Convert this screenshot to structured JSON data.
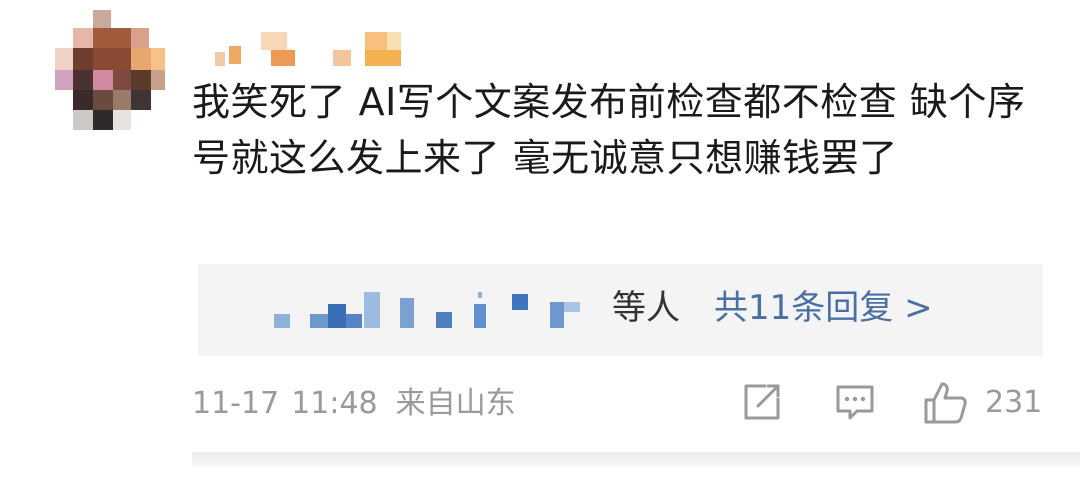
{
  "comment": {
    "text": "我笑死了 AI写个文案发布前检查都不检查 缺个序号就这么发上来了  毫无诚意只想赚钱罢了"
  },
  "replies": {
    "others_text": "等人",
    "count_text": "共11条回复 >"
  },
  "meta": {
    "date": "11-17",
    "time": "11:48",
    "location": "来自山东"
  },
  "actions": {
    "like_count": "231",
    "share_icon": "share-icon",
    "comment_icon": "comment-icon",
    "like_icon": "thumbs-up-icon"
  },
  "colors": {
    "text": "#1a1a1a",
    "link": "#4a6fa5",
    "muted": "#9a9a9a",
    "reply_bg": "#f4f4f5"
  }
}
